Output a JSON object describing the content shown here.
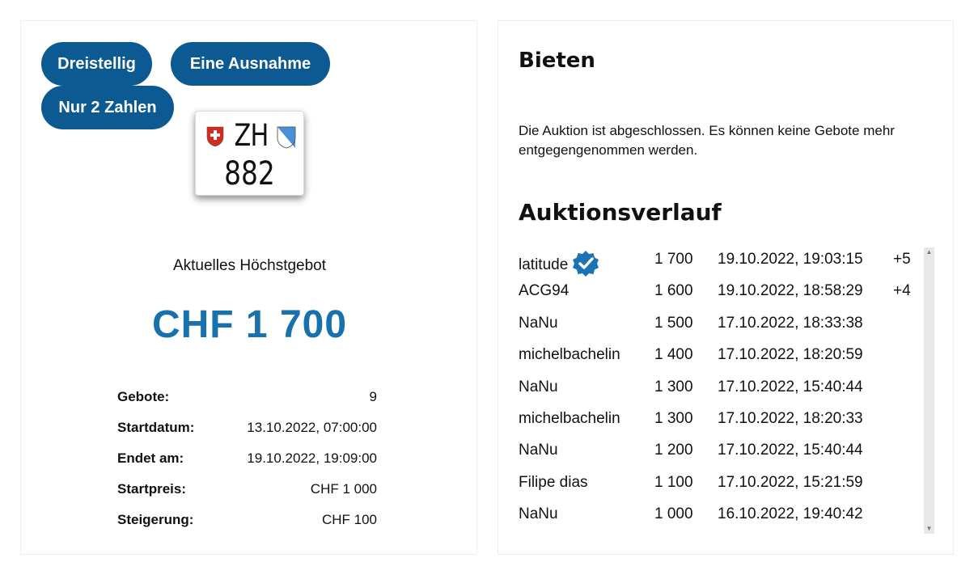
{
  "tags": [
    "Dreistellig",
    "Eine Ausnahme",
    "Nur 2 Zahlen"
  ],
  "plate": {
    "canton": "ZH",
    "number": "882"
  },
  "current_bid": {
    "label": "Aktuelles Höchstgebot",
    "amount": "CHF 1 700"
  },
  "info": [
    {
      "key": "Gebote:",
      "value": "9"
    },
    {
      "key": "Startdatum:",
      "value": "13.10.2022, 07:00:00"
    },
    {
      "key": "Endet am:",
      "value": "19.10.2022, 19:09:00"
    },
    {
      "key": "Startpreis:",
      "value": "CHF 1 000"
    },
    {
      "key": "Steigerung:",
      "value": "CHF 100"
    }
  ],
  "bieten": {
    "title": "Bieten",
    "message": "Die Auktion ist abgeschlossen. Es können keine Gebote mehr entgegengenommen werden."
  },
  "history": {
    "title": "Auktionsverlauf",
    "rows": [
      {
        "user": "latitude",
        "amount": "1 700",
        "date": "19.10.2022, 19:03:15",
        "extra": "+5",
        "verified": true
      },
      {
        "user": "ACG94",
        "amount": "1 600",
        "date": "19.10.2022, 18:58:29",
        "extra": "+4",
        "verified": false
      },
      {
        "user": "NaNu",
        "amount": "1 500",
        "date": "17.10.2022, 18:33:38",
        "extra": "",
        "verified": false
      },
      {
        "user": "michelbachelin",
        "amount": "1 400",
        "date": "17.10.2022, 18:20:59",
        "extra": "",
        "verified": false
      },
      {
        "user": "NaNu",
        "amount": "1 300",
        "date": "17.10.2022, 15:40:44",
        "extra": "",
        "verified": false
      },
      {
        "user": "michelbachelin",
        "amount": "1 300",
        "date": "17.10.2022, 18:20:33",
        "extra": "",
        "verified": false
      },
      {
        "user": "NaNu",
        "amount": "1 200",
        "date": "17.10.2022, 15:40:44",
        "extra": "",
        "verified": false
      },
      {
        "user": "Filipe dias",
        "amount": "1 100",
        "date": "17.10.2022, 15:21:59",
        "extra": "",
        "verified": false
      },
      {
        "user": "NaNu",
        "amount": "1 000",
        "date": "16.10.2022, 19:40:42",
        "extra": "",
        "verified": false
      }
    ]
  },
  "colors": {
    "accent": "#0d5a93",
    "amount": "#1671ad"
  },
  "icons": [
    "swiss-flag-icon",
    "zurich-shield-icon",
    "verified-badge-icon",
    "scroll-up-icon",
    "scroll-down-icon"
  ]
}
